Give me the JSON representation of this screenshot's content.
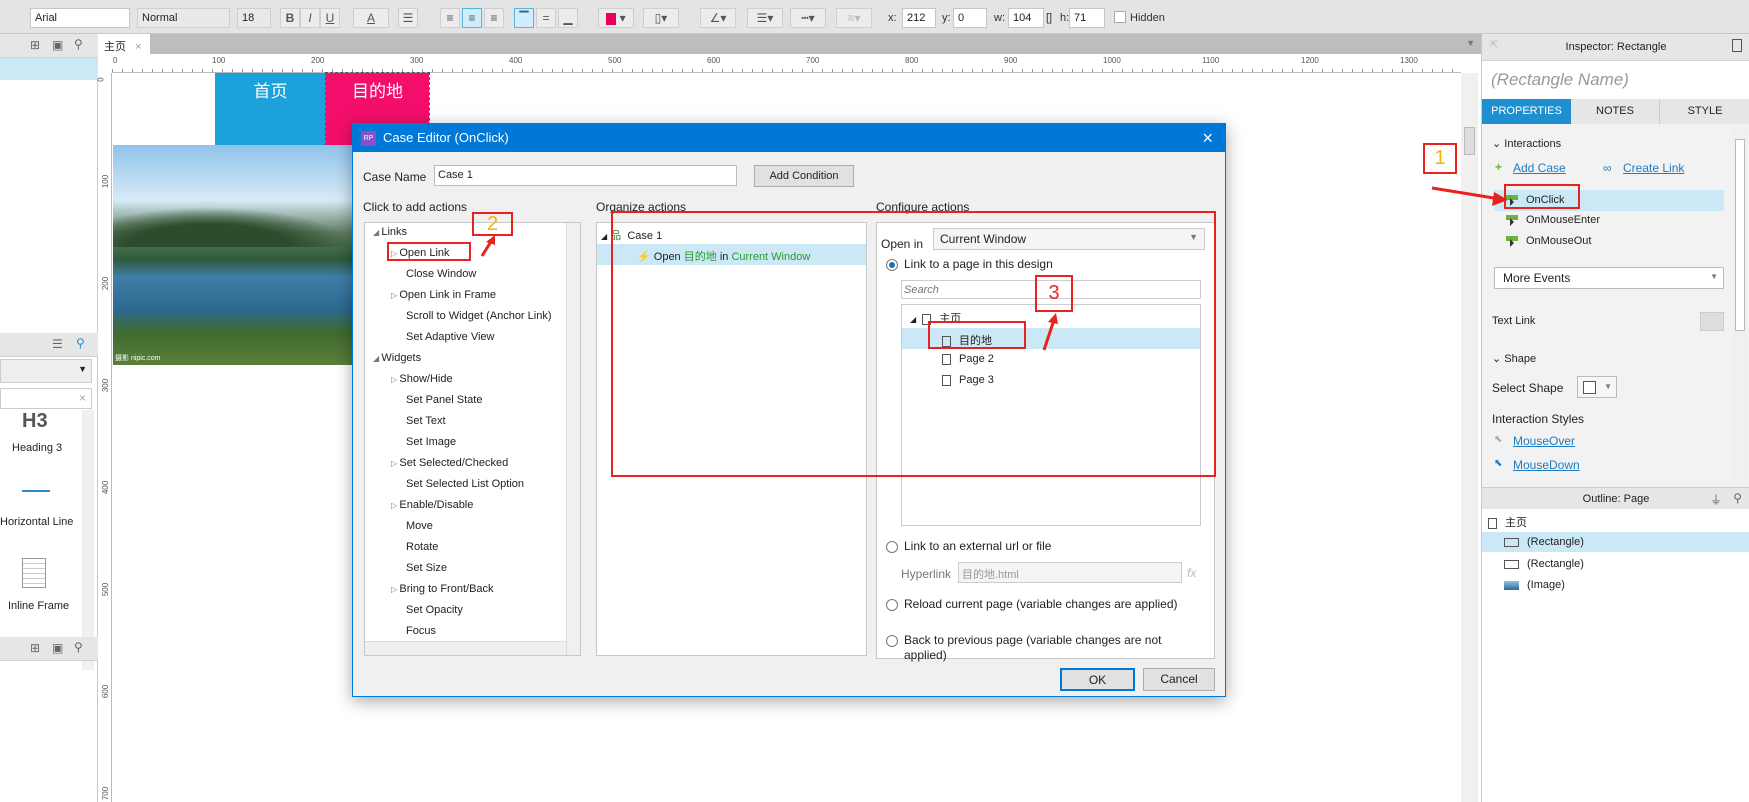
{
  "toolbar": {
    "font": "Arial",
    "style": "Normal",
    "size": "18",
    "bold": "B",
    "italic": "I",
    "underline": "U",
    "font_color": "A",
    "x_label": "x:",
    "x": "212",
    "y_label": "y:",
    "y": "0",
    "w_label": "w:",
    "w": "104",
    "h_label": "h:",
    "h": "71",
    "hidden": "Hidden",
    "fill_color": "#e8005a"
  },
  "canvas": {
    "tab": "主页",
    "ruler_top": [
      "0",
      "100",
      "200",
      "300",
      "400",
      "500",
      "600",
      "700",
      "800",
      "900",
      "1000",
      "1100",
      "1200",
      "1300"
    ],
    "ruler_left": [
      "0",
      "100",
      "200",
      "300",
      "400",
      "500",
      "600",
      "700"
    ],
    "rect1": {
      "text": "首页",
      "color": "#1da1db"
    },
    "rect2": {
      "text": "目的地",
      "color": "#f20e6a"
    },
    "image_caption": "摄影 nipic.com"
  },
  "widgets": {
    "items": [
      {
        "icon": "H3",
        "label": "Heading 3"
      },
      {
        "label": "Horizontal Line"
      },
      {
        "label": "Inline Frame"
      }
    ]
  },
  "dialog": {
    "title": "Case Editor (OnClick)",
    "logo": "RP",
    "case_name_label": "Case Name",
    "case_name": "Case 1",
    "add_condition": "Add Condition",
    "add_actions_title": "Click to add actions",
    "actions": [
      {
        "label": "Links",
        "group": true
      },
      {
        "label": "Open Link",
        "arrow": true
      },
      {
        "label": "Close Window"
      },
      {
        "label": "Open Link in Frame",
        "arrow": true
      },
      {
        "label": "Scroll to Widget (Anchor Link)"
      },
      {
        "label": "Set Adaptive View"
      },
      {
        "label": "Widgets",
        "group": true
      },
      {
        "label": "Show/Hide",
        "arrow": true
      },
      {
        "label": "Set Panel State"
      },
      {
        "label": "Set Text"
      },
      {
        "label": "Set Image"
      },
      {
        "label": "Set Selected/Checked",
        "arrow": true
      },
      {
        "label": "Set Selected List Option"
      },
      {
        "label": "Enable/Disable",
        "arrow": true
      },
      {
        "label": "Move"
      },
      {
        "label": "Rotate"
      },
      {
        "label": "Set Size"
      },
      {
        "label": "Bring to Front/Back",
        "arrow": true
      },
      {
        "label": "Set Opacity"
      },
      {
        "label": "Focus"
      }
    ],
    "organize_title": "Organize actions",
    "case": "Case 1",
    "action_open": "Open",
    "action_target": "目的地",
    "action_in": "in",
    "action_window": "Current Window",
    "configure_title": "Configure actions",
    "open_in_label": "Open in",
    "open_in": "Current Window",
    "link_page": "Link to a page in this design",
    "search_placeholder": "Search",
    "pages": [
      {
        "label": "主页",
        "root": true
      },
      {
        "label": "目的地",
        "selected": true
      },
      {
        "label": "Page 2"
      },
      {
        "label": "Page 3"
      }
    ],
    "link_external": "Link to an external url or file",
    "hyperlink_label": "Hyperlink",
    "hyperlink": "目的地.html",
    "fx": "fx",
    "reload": "Reload current page (variable changes are applied)",
    "back": "Back to previous page (variable changes are not applied)",
    "ok": "OK",
    "cancel": "Cancel"
  },
  "inspector": {
    "title": "Inspector: Rectangle",
    "name_placeholder": "(Rectangle Name)",
    "tabs": [
      "PROPERTIES",
      "NOTES",
      "STYLE"
    ],
    "interactions": "Interactions",
    "add_case": "Add Case",
    "create_link": "Create Link",
    "events": [
      "OnClick",
      "OnMouseEnter",
      "OnMouseOut"
    ],
    "more_events": "More Events",
    "text_link": "Text Link",
    "shape": "Shape",
    "select_shape": "Select Shape",
    "interaction_styles": "Interaction Styles",
    "mouseover": "MouseOver",
    "mousedown": "MouseDown"
  },
  "outline": {
    "title": "Outline: Page",
    "root": "主页",
    "items": [
      "(Rectangle)",
      "(Rectangle)",
      "(Image)"
    ]
  },
  "annotations": [
    "1",
    "2",
    "3"
  ]
}
